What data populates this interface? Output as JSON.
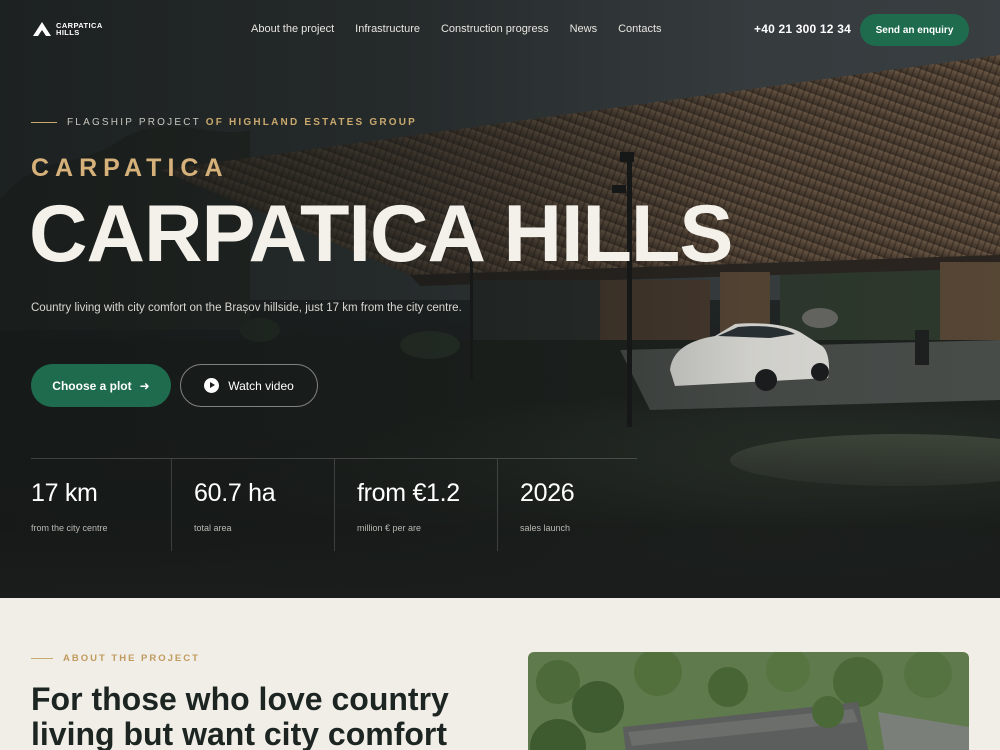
{
  "brand": {
    "line1": "CARPATICA",
    "line2": "HILLS"
  },
  "nav": {
    "links": [
      "About the project",
      "Infrastructure",
      "Construction progress",
      "News",
      "Contacts"
    ],
    "phone": "+40 21 300 12 34",
    "cta": "Send an enquiry"
  },
  "hero": {
    "eyebrow_lead": "FLAGSHIP PROJECT ",
    "eyebrow_strong": "OF HIGHLAND ESTATES GROUP",
    "kicker": "CARPATICA",
    "title": "CARPATICA HILLS",
    "subtitle": "Country living with city comfort on the Brașov hillside, just 17 km from the city centre.",
    "primary_button": "Choose a plot",
    "secondary_button": "Watch video",
    "stats": [
      {
        "value": "17 km",
        "label": "from the city centre"
      },
      {
        "value": "60.7 ha",
        "label": "total area"
      },
      {
        "value": "from €1.2",
        "label": "million € per are"
      },
      {
        "value": "2026",
        "label": "sales launch"
      }
    ]
  },
  "about": {
    "eyebrow": "ABOUT THE PROJECT",
    "title": "For those who love country living but want city comfort"
  },
  "colors": {
    "accent_green": "#1f6b4d",
    "gold": "#c9a96e",
    "cream": "#f1eee7",
    "dark": "#1a1d1c"
  }
}
